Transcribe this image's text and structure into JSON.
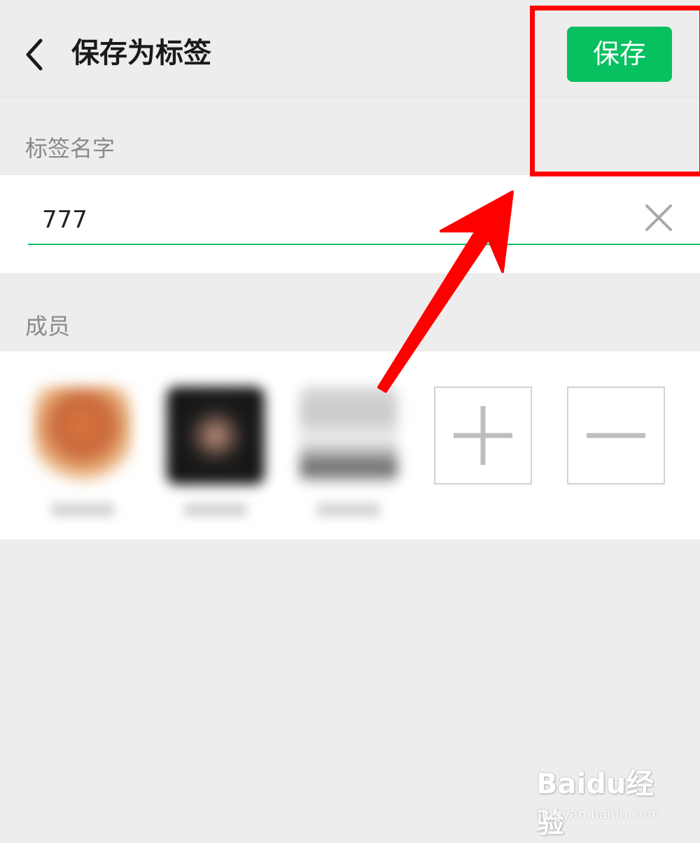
{
  "header": {
    "back_icon": "chevron-left-icon",
    "title": "保存为标签",
    "save_label": "保存",
    "save_color": "#07c160"
  },
  "tag_name_section": {
    "label": "标签名字",
    "input_value": "777",
    "clear_icon": "close-icon",
    "underline_color": "#07c160"
  },
  "members_section": {
    "label": "成员",
    "members": [
      {
        "avatar": "blurred-avatar"
      },
      {
        "avatar": "blurred-avatar"
      },
      {
        "avatar": "blurred-avatar"
      }
    ],
    "add_icon": "plus-icon",
    "remove_icon": "minus-icon"
  },
  "annotation": {
    "color": "#ff0000",
    "box_target": "save-button",
    "arrow_icon": "arrow-up-right-icon"
  },
  "watermark": {
    "logo": "Baidu经验",
    "url": "jingyan.baidu.com"
  }
}
